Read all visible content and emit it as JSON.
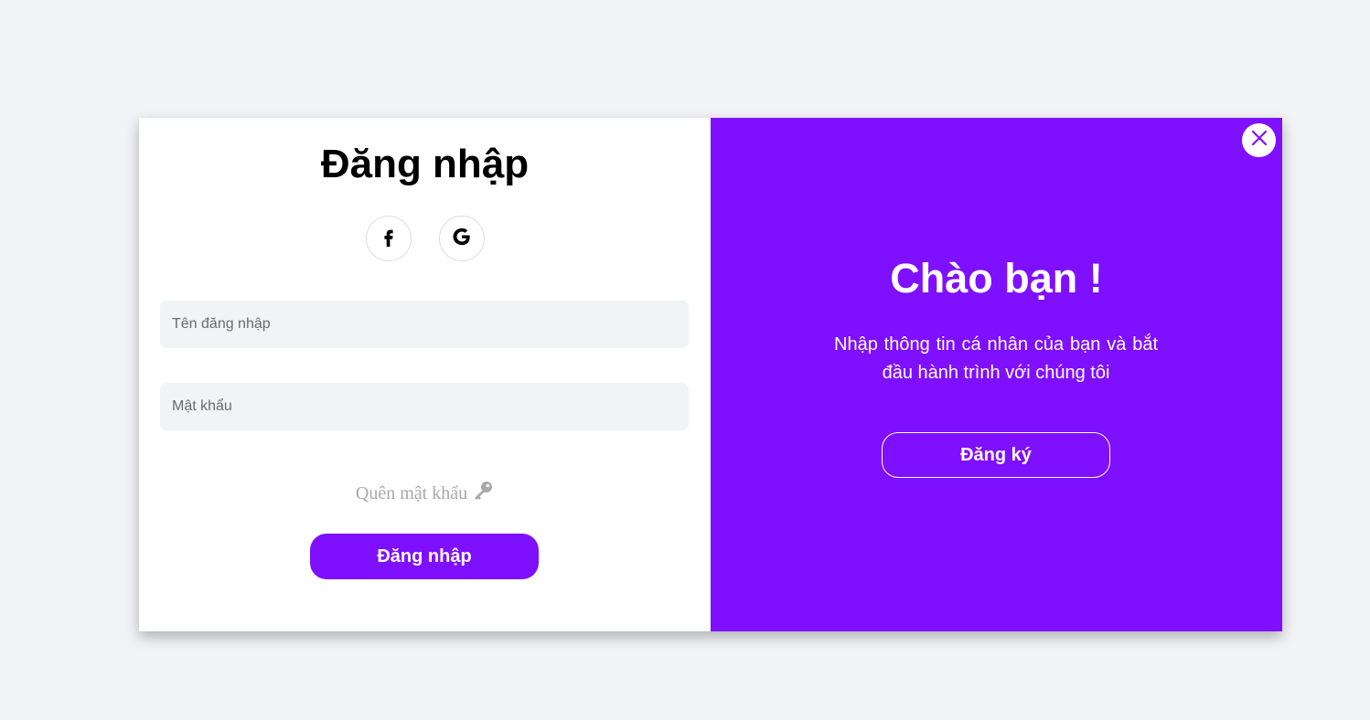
{
  "login": {
    "title": "Đăng nhập",
    "social": [
      {
        "name": "facebook-icon",
        "glyph": "f"
      },
      {
        "name": "google-icon",
        "glyph": "G"
      }
    ],
    "username_placeholder": "Tên đăng nhập",
    "password_placeholder": "Mật khẩu",
    "forgot_label": "Quên mật khẩu",
    "forgot_icon": "key-icon",
    "submit_label": "Đăng nhập"
  },
  "welcome": {
    "title": "Chào bạn !",
    "text": "Nhập thông tin cá nhân của bạn và bắt đầu hành trình với chúng tôi",
    "signup_label": "Đăng ký",
    "close_icon": "close-icon"
  },
  "colors": {
    "accent": "#7f0fff",
    "page_background": "#f2f3f7",
    "input_background": "#f2f3f7",
    "muted_text": "#a9a9a9"
  }
}
